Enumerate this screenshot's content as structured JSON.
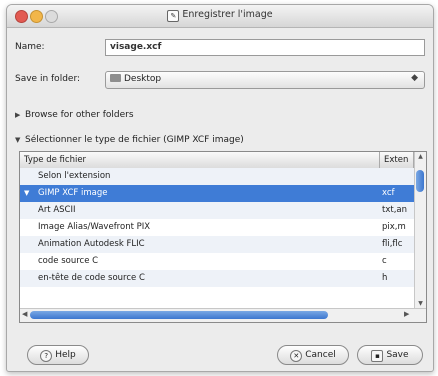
{
  "window": {
    "title": "Enregistrer l'image",
    "title_icon": "app-window-icon"
  },
  "form": {
    "name_label": "Name:",
    "name_value": "visage.xcf",
    "folder_label": "Save in folder:",
    "folder_value": "Desktop"
  },
  "expanders": {
    "browse_label": "Browse for other folders",
    "filetype_label": "Sélectionner le type de fichier (GIMP XCF image)"
  },
  "table": {
    "headers": [
      "Type de fichier",
      "Exten"
    ],
    "rows": [
      {
        "type": "Selon l'extension",
        "ext": ""
      },
      {
        "type": "GIMP XCF image",
        "ext": "xcf"
      },
      {
        "type": "Art ASCII",
        "ext": "txt,an"
      },
      {
        "type": "Image Alias/Wavefront PIX",
        "ext": "pix,m"
      },
      {
        "type": "Animation Autodesk FLIC",
        "ext": "fli,flc"
      },
      {
        "type": "code source C",
        "ext": "c"
      },
      {
        "type": "en-tête de code source C",
        "ext": "h"
      }
    ],
    "selected_index": 1
  },
  "buttons": {
    "help": "Help",
    "cancel": "Cancel",
    "save": "Save"
  },
  "colors": {
    "selection": "#3f7cd6",
    "close": "#e25a52",
    "minimize": "#f2b64a"
  }
}
